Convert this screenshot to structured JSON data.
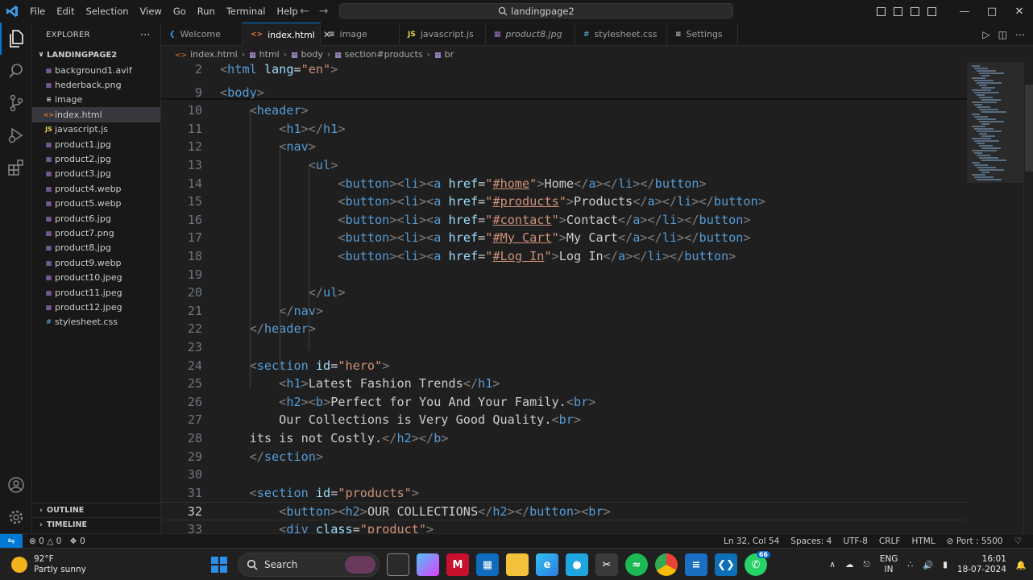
{
  "titlebar": {
    "menu": [
      "File",
      "Edit",
      "Selection",
      "View",
      "Go",
      "Run",
      "Terminal",
      "Help"
    ],
    "search_text": "landingpage2"
  },
  "explorer": {
    "title": "EXPLORER",
    "folder": "LANDINGPAGE2",
    "files": [
      {
        "name": "background1.avif",
        "type": "img"
      },
      {
        "name": "hederback.png",
        "type": "img"
      },
      {
        "name": "image",
        "type": "file"
      },
      {
        "name": "index.html",
        "type": "html"
      },
      {
        "name": "javascript.js",
        "type": "js"
      },
      {
        "name": "product1.jpg",
        "type": "img"
      },
      {
        "name": "product2.jpg",
        "type": "img"
      },
      {
        "name": "product3.jpg",
        "type": "img"
      },
      {
        "name": "product4.webp",
        "type": "img"
      },
      {
        "name": "product5.webp",
        "type": "img"
      },
      {
        "name": "product6.jpg",
        "type": "img"
      },
      {
        "name": "product7.png",
        "type": "img"
      },
      {
        "name": "product8.jpg",
        "type": "img"
      },
      {
        "name": "product9.webp",
        "type": "img"
      },
      {
        "name": "product10.jpeg",
        "type": "img"
      },
      {
        "name": "product11.jpeg",
        "type": "img"
      },
      {
        "name": "product12.jpeg",
        "type": "img"
      },
      {
        "name": "stylesheet.css",
        "type": "css"
      }
    ],
    "outline": "OUTLINE",
    "timeline": "TIMELINE"
  },
  "tabs": [
    {
      "label": "Welcome",
      "icon": "vscode"
    },
    {
      "label": "index.html",
      "icon": "html",
      "active": true
    },
    {
      "label": "image",
      "icon": "file"
    },
    {
      "label": "javascript.js",
      "icon": "js"
    },
    {
      "label": "product8.jpg",
      "icon": "img",
      "italic": true
    },
    {
      "label": "stylesheet.css",
      "icon": "css"
    },
    {
      "label": "Settings",
      "icon": "settings"
    }
  ],
  "breadcrumb": [
    "index.html",
    "html",
    "body",
    "section#products",
    "br"
  ],
  "editor": {
    "current_line": 32,
    "lines": [
      {
        "n": 2,
        "html": "<span class='t'>&lt;</span><span class='n'>html</span> <span class='a'>lang</span>=<span class='s'>\"en\"</span><span class='t'>&gt;</span>"
      },
      {
        "n": 9,
        "html": "<span class='t'>&lt;</span><span class='n'>body</span><span class='t'>&gt;</span>"
      },
      {
        "n": 10,
        "html": "    <span class='t'>&lt;</span><span class='n'>header</span><span class='t'>&gt;</span>"
      },
      {
        "n": 11,
        "html": "        <span class='t'>&lt;</span><span class='n'>h1</span><span class='t'>&gt;&lt;/</span><span class='n'>h1</span><span class='t'>&gt;</span>"
      },
      {
        "n": 12,
        "html": "        <span class='t'>&lt;</span><span class='n'>nav</span><span class='t'>&gt;</span>"
      },
      {
        "n": 13,
        "html": "            <span class='t'>&lt;</span><span class='n'>ul</span><span class='t'>&gt;</span>"
      },
      {
        "n": 14,
        "html": "                <span class='t'>&lt;</span><span class='n'>button</span><span class='t'>&gt;&lt;</span><span class='n'>li</span><span class='t'>&gt;&lt;</span><span class='n'>a</span> <span class='a'>href</span>=<span class='s'>\"<span class='u'>#home</span>\"</span><span class='t'>&gt;</span>Home<span class='t'>&lt;/</span><span class='n'>a</span><span class='t'>&gt;&lt;/</span><span class='n'>li</span><span class='t'>&gt;&lt;/</span><span class='n'>button</span><span class='t'>&gt;</span>"
      },
      {
        "n": 15,
        "html": "                <span class='t'>&lt;</span><span class='n'>button</span><span class='t'>&gt;&lt;</span><span class='n'>li</span><span class='t'>&gt;&lt;</span><span class='n'>a</span> <span class='a'>href</span>=<span class='s'>\"<span class='u'>#products</span>\"</span><span class='t'>&gt;</span>Products<span class='t'>&lt;/</span><span class='n'>a</span><span class='t'>&gt;&lt;/</span><span class='n'>li</span><span class='t'>&gt;&lt;/</span><span class='n'>button</span><span class='t'>&gt;</span>"
      },
      {
        "n": 16,
        "html": "                <span class='t'>&lt;</span><span class='n'>button</span><span class='t'>&gt;&lt;</span><span class='n'>li</span><span class='t'>&gt;&lt;</span><span class='n'>a</span> <span class='a'>href</span>=<span class='s'>\"<span class='u'>#contact</span>\"</span><span class='t'>&gt;</span>Contact<span class='t'>&lt;/</span><span class='n'>a</span><span class='t'>&gt;&lt;/</span><span class='n'>li</span><span class='t'>&gt;&lt;/</span><span class='n'>button</span><span class='t'>&gt;</span>"
      },
      {
        "n": 17,
        "html": "                <span class='t'>&lt;</span><span class='n'>button</span><span class='t'>&gt;&lt;</span><span class='n'>li</span><span class='t'>&gt;&lt;</span><span class='n'>a</span> <span class='a'>href</span>=<span class='s'>\"<span class='u'>#My Cart</span>\"</span><span class='t'>&gt;</span>My Cart<span class='t'>&lt;/</span><span class='n'>a</span><span class='t'>&gt;&lt;/</span><span class='n'>li</span><span class='t'>&gt;&lt;/</span><span class='n'>button</span><span class='t'>&gt;</span>"
      },
      {
        "n": 18,
        "html": "                <span class='t'>&lt;</span><span class='n'>button</span><span class='t'>&gt;&lt;</span><span class='n'>li</span><span class='t'>&gt;&lt;</span><span class='n'>a</span> <span class='a'>href</span>=<span class='s'>\"<span class='u'>#Log In</span>\"</span><span class='t'>&gt;</span>Log In<span class='t'>&lt;/</span><span class='n'>a</span><span class='t'>&gt;&lt;/</span><span class='n'>li</span><span class='t'>&gt;&lt;/</span><span class='n'>button</span><span class='t'>&gt;</span>"
      },
      {
        "n": 19,
        "html": ""
      },
      {
        "n": 20,
        "html": "            <span class='t'>&lt;/</span><span class='n'>ul</span><span class='t'>&gt;</span>"
      },
      {
        "n": 21,
        "html": "        <span class='t'>&lt;/</span><span class='n'>nav</span><span class='t'>&gt;</span>"
      },
      {
        "n": 22,
        "html": "    <span class='t'>&lt;/</span><span class='n'>header</span><span class='t'>&gt;</span>"
      },
      {
        "n": 23,
        "html": ""
      },
      {
        "n": 24,
        "html": "    <span class='t'>&lt;</span><span class='n'>section</span> <span class='a'>id</span>=<span class='s'>\"hero\"</span><span class='t'>&gt;</span>"
      },
      {
        "n": 25,
        "html": "        <span class='t'>&lt;</span><span class='n'>h1</span><span class='t'>&gt;</span>Latest Fashion Trends<span class='t'>&lt;/</span><span class='n'>h1</span><span class='t'>&gt;</span>"
      },
      {
        "n": 26,
        "html": "        <span class='t'>&lt;</span><span class='n'>h2</span><span class='t'>&gt;&lt;</span><span class='n'>b</span><span class='t'>&gt;</span>Perfect for You And Your Family.<span class='t'>&lt;</span><span class='n'>br</span><span class='t'>&gt;</span>"
      },
      {
        "n": 27,
        "html": "        Our Collections is Very Good Quality.<span class='t'>&lt;</span><span class='n'>br</span><span class='t'>&gt;</span>"
      },
      {
        "n": 28,
        "html": "    its is not Costly.<span class='t'>&lt;/</span><span class='n'>h2</span><span class='t'>&gt;&lt;/</span><span class='n'>b</span><span class='t'>&gt;</span>"
      },
      {
        "n": 29,
        "html": "    <span class='t'>&lt;/</span><span class='n'>section</span><span class='t'>&gt;</span>"
      },
      {
        "n": 30,
        "html": ""
      },
      {
        "n": 31,
        "html": "    <span class='t'>&lt;</span><span class='n'>section</span> <span class='a'>id</span>=<span class='s'>\"products\"</span><span class='t'>&gt;</span>"
      },
      {
        "n": 32,
        "html": "        <span class='t'>&lt;</span><span class='n'>button</span><span class='t'>&gt;&lt;</span><span class='n'>h2</span><span class='t'>&gt;</span>OUR COLLECTIONS<span class='t'>&lt;/</span><span class='n'>h2</span><span class='t'>&gt;&lt;/</span><span class='n'>button</span><span class='t'>&gt;&lt;</span><span class='n'>br</span><span class='t'>&gt;</span>"
      },
      {
        "n": 33,
        "html": "        <span class='t'>&lt;</span><span class='n'>div</span> <span class='a'>class</span>=<span class='s'>\"product\"</span><span class='t'>&gt;</span>"
      }
    ]
  },
  "statusbar": {
    "errors": "0",
    "warnings": "0",
    "ports": "0",
    "position": "Ln 32, Col 54",
    "spaces": "Spaces: 4",
    "encoding": "UTF-8",
    "eol": "CRLF",
    "language": "HTML",
    "port": "Port : 5500"
  },
  "taskbar": {
    "temp": "92°F",
    "weather": "Partly sunny",
    "search": "Search",
    "badge": "66",
    "lang1": "ENG",
    "lang2": "IN",
    "time": "16:01",
    "date": "18-07-2024"
  },
  "colors": {
    "accent": "#0078d4",
    "tag": "#569cd6",
    "attr": "#9cdcfe",
    "string": "#ce9178"
  }
}
